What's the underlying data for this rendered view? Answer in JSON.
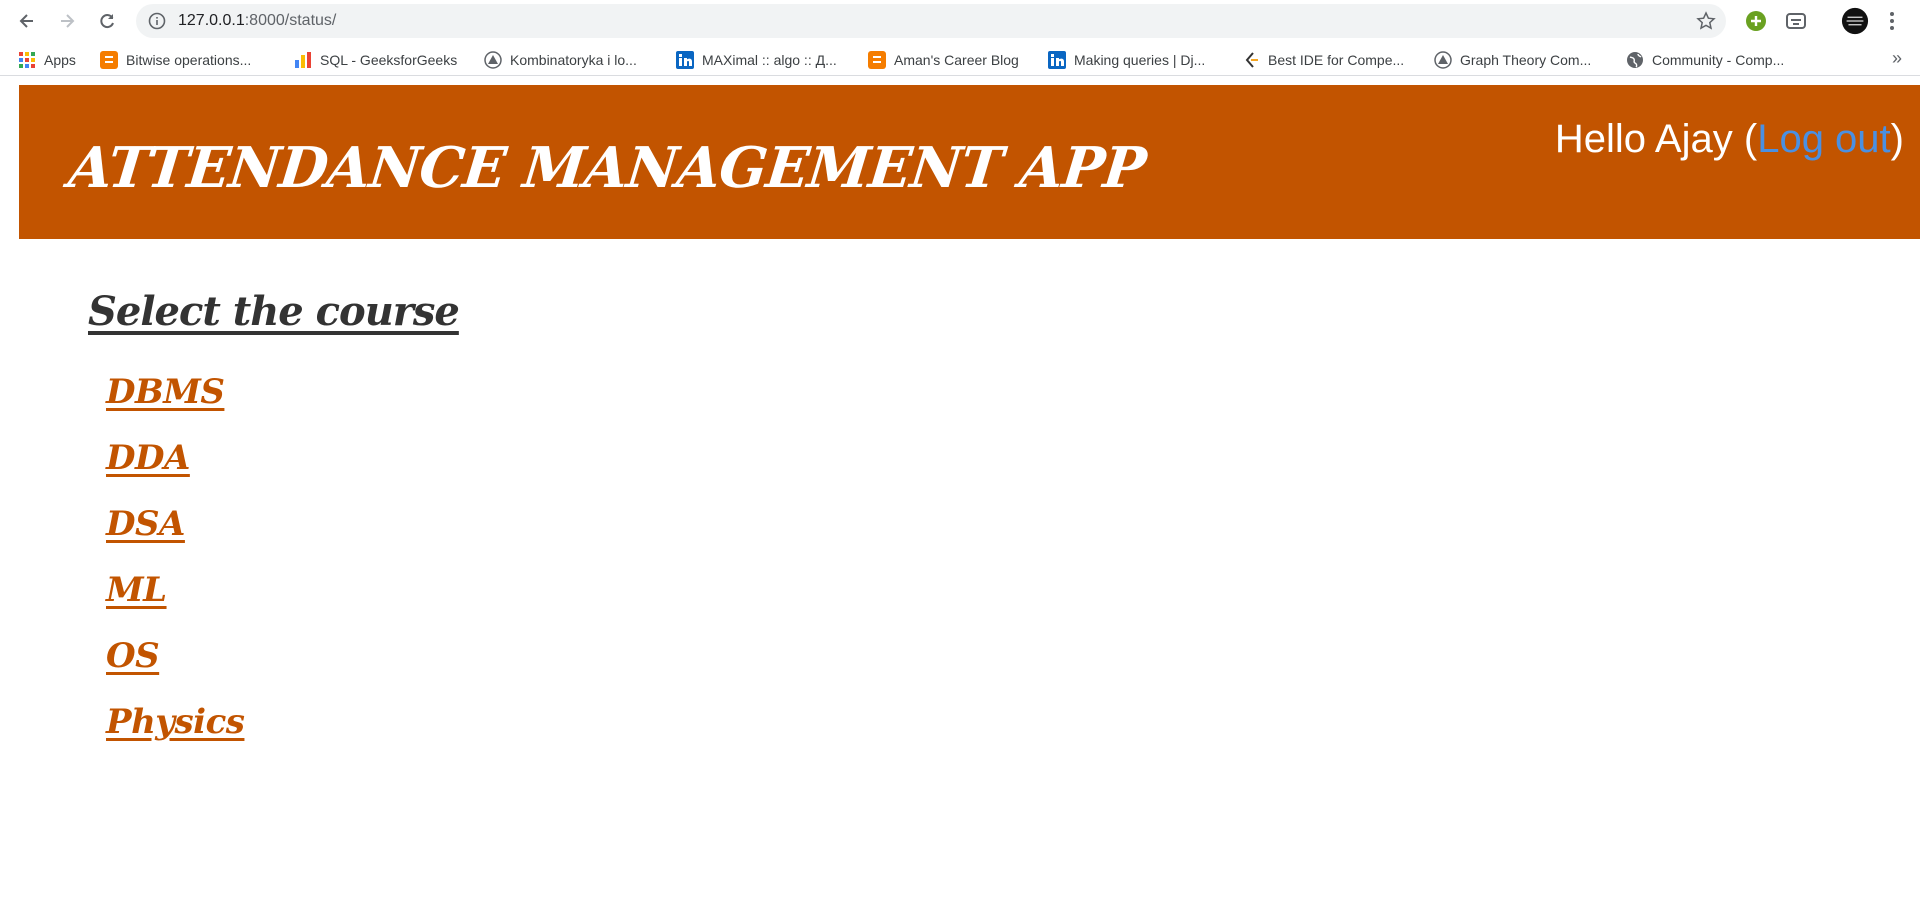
{
  "browser": {
    "url_host": "127.0.0.1",
    "url_path": ":8000/status/",
    "bookmarks": [
      {
        "label": "Apps",
        "icon": "apps-grid-icon"
      },
      {
        "label": "Bitwise operations...",
        "icon": "blogger-icon"
      },
      {
        "label": "SQL - GeeksforGeeks",
        "icon": "chart-icon"
      },
      {
        "label": "Kombinatoryka i lo...",
        "icon": "triangle-logo-icon"
      },
      {
        "label": "MAXimal :: algo :: Д...",
        "icon": "linkedin-icon"
      },
      {
        "label": "Aman's Career Blog",
        "icon": "blogger-icon"
      },
      {
        "label": "Making queries | Dj...",
        "icon": "linkedin-icon"
      },
      {
        "label": "Best IDE for Compe...",
        "icon": "code-logo-icon"
      },
      {
        "label": "Graph Theory Com...",
        "icon": "triangle-logo-icon"
      },
      {
        "label": "Community - Comp...",
        "icon": "globe-icon"
      }
    ],
    "more": "»"
  },
  "header": {
    "title": "ATTENDANCE MANAGEMENT APP",
    "greeting": "Hello Ajay",
    "open_paren": "(",
    "logout": "Log out",
    "close_paren": ")"
  },
  "main": {
    "heading": "Select the course",
    "courses": [
      "DBMS",
      "DDA",
      "DSA",
      "ML",
      "OS",
      "Physics"
    ]
  },
  "colors": {
    "accent": "#c25400",
    "link": "#4a90e2",
    "heading": "#333333"
  }
}
